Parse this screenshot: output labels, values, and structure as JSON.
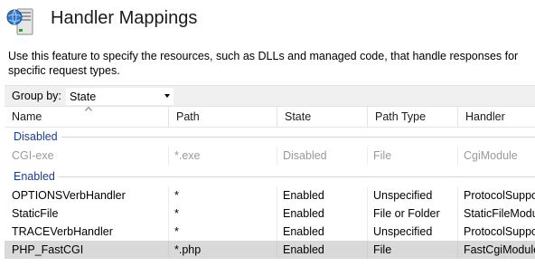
{
  "header": {
    "title": "Handler Mappings",
    "icon": "handler-mappings-icon",
    "description": "Use this feature to specify the resources, such as DLLs and managed code, that handle responses for specific request types."
  },
  "groupbar": {
    "label": "Group by:",
    "selected": "State"
  },
  "columns": [
    "Name",
    "Path",
    "State",
    "Path Type",
    "Handler"
  ],
  "groups": [
    {
      "label": "Disabled",
      "rows": [
        {
          "name": "CGI-exe",
          "path": "*.exe",
          "state": "Disabled",
          "path_type": "File",
          "handler": "CgiModule"
        }
      ]
    },
    {
      "label": "Enabled",
      "rows": [
        {
          "name": "OPTIONSVerbHandler",
          "path": "*",
          "state": "Enabled",
          "path_type": "Unspecified",
          "handler": "ProtocolSupportModule"
        },
        {
          "name": "StaticFile",
          "path": "*",
          "state": "Enabled",
          "path_type": "File or Folder",
          "handler": "StaticFileModule"
        },
        {
          "name": "TRACEVerbHandler",
          "path": "*",
          "state": "Enabled",
          "path_type": "Unspecified",
          "handler": "ProtocolSupportModule"
        },
        {
          "name": "PHP_FastCGI",
          "path": "*.php",
          "state": "Enabled",
          "path_type": "File",
          "handler": "FastCgiModule"
        }
      ]
    }
  ],
  "colors": {
    "group_header_text": "#1e3c8c",
    "selected_row": "#d9d9d9",
    "disabled_text": "#9a9a9a"
  }
}
